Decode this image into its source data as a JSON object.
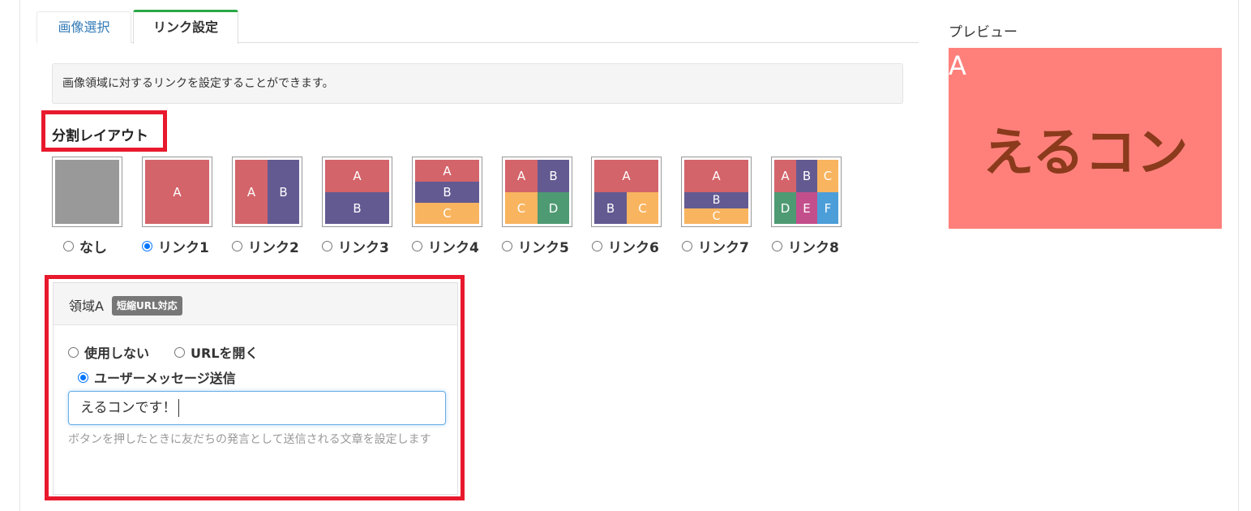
{
  "tabs": [
    {
      "label": "画像選択",
      "active": false
    },
    {
      "label": "リンク設定",
      "active": true
    }
  ],
  "info_text": "画像領域に対するリンクを設定することができます。",
  "section_title": "分割レイアウト",
  "layouts": [
    {
      "label": "なし",
      "selected": false
    },
    {
      "label": "リンク1",
      "selected": true
    },
    {
      "label": "リンク2",
      "selected": false
    },
    {
      "label": "リンク3",
      "selected": false
    },
    {
      "label": "リンク4",
      "selected": false
    },
    {
      "label": "リンク5",
      "selected": false
    },
    {
      "label": "リンク6",
      "selected": false
    },
    {
      "label": "リンク7",
      "selected": false
    },
    {
      "label": "リンク8",
      "selected": false
    }
  ],
  "cells": {
    "a": "A",
    "b": "B",
    "c": "C",
    "d": "D",
    "e": "E",
    "f": "F"
  },
  "area": {
    "title": "領域A",
    "badge": "短縮URL対応",
    "options": [
      "使用しない",
      "URLを開く",
      "ユーザーメッセージ送信"
    ],
    "selected_option": "ユーザーメッセージ送信",
    "input_value": "えるコンです！",
    "help": "ボタンを押したときに友だちの発言として送信される文章を設定します"
  },
  "preview": {
    "label": "プレビュー",
    "letter": "A",
    "text": "えるコン"
  },
  "colors": {
    "tab_active_border": "#2aa745",
    "highlight_red": "#e8192c",
    "cell_red": "#d3646a",
    "cell_purple": "#635a92",
    "cell_orange": "#f9b45f",
    "cell_green": "#4e9a73",
    "cell_magenta": "#c34e8c",
    "cell_blue": "#4c9ed8",
    "preview_bg": "#ff807b",
    "preview_text": "#8b3a1c"
  }
}
